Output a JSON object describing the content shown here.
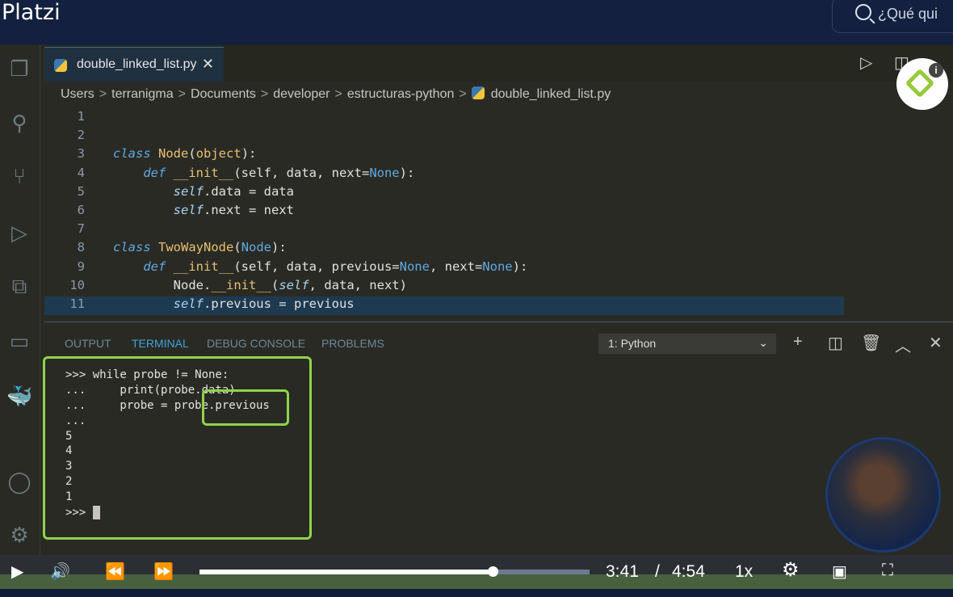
{
  "header": {
    "logo": "Platzi",
    "search_placeholder": "¿Qué qui"
  },
  "editor": {
    "tab": "double_linked_list.py",
    "breadcrumbs": [
      "Users",
      "terranigma",
      "Documents",
      "developer",
      "estructuras-python",
      "double_linked_list.py"
    ],
    "lines": [
      {
        "n": "1",
        "html": ""
      },
      {
        "n": "2",
        "html": ""
      },
      {
        "n": "3",
        "html": "<span class='kw'>class</span> <span class='cn'>Node</span>(<span class='cn'>object</span>):"
      },
      {
        "n": "4",
        "html": "    <span class='kw'>def</span> <span class='cn'>__init__</span>(self, data, next=<span class='bi'>None</span>):"
      },
      {
        "n": "5",
        "html": "        <span class='self'>self</span>.data = data"
      },
      {
        "n": "6",
        "html": "        <span class='self'>self</span>.next = next"
      },
      {
        "n": "7",
        "html": ""
      },
      {
        "n": "8",
        "html": "<span class='kw'>class</span> <span class='cn'>TwoWayNode</span>(<span class='bi'>Node</span>):"
      },
      {
        "n": "9",
        "html": "    <span class='kw'>def</span> <span class='cn'>__init__</span>(self, data, previous=<span class='bi'>None</span>, next=<span class='bi'>None</span>):"
      },
      {
        "n": "10",
        "html": "        Node.<span class='cn'>__init__</span>(<span class='self'>self</span>, data, next)"
      },
      {
        "n": "11",
        "html": "        <span class='self'>self</span>.previous = previous"
      }
    ]
  },
  "panel": {
    "tabs": [
      "OUTPUT",
      "TERMINAL",
      "DEBUG CONSOLE",
      "PROBLEMS"
    ],
    "active_tab": "TERMINAL",
    "terminal_select": "1: Python",
    "terminal_lines": [
      ">>> while probe != None:",
      "...     print(probe.data)",
      "...     probe = probe.previous",
      "...",
      "5",
      "4",
      "3",
      "2",
      "1",
      ">>> "
    ]
  },
  "player": {
    "current_time": "3:41",
    "separator": "/",
    "duration": "4:54",
    "speed": "1x",
    "progress_percent": 75.2
  },
  "colors": {
    "highlight": "#8fd44b",
    "topbar": "#13203f"
  }
}
